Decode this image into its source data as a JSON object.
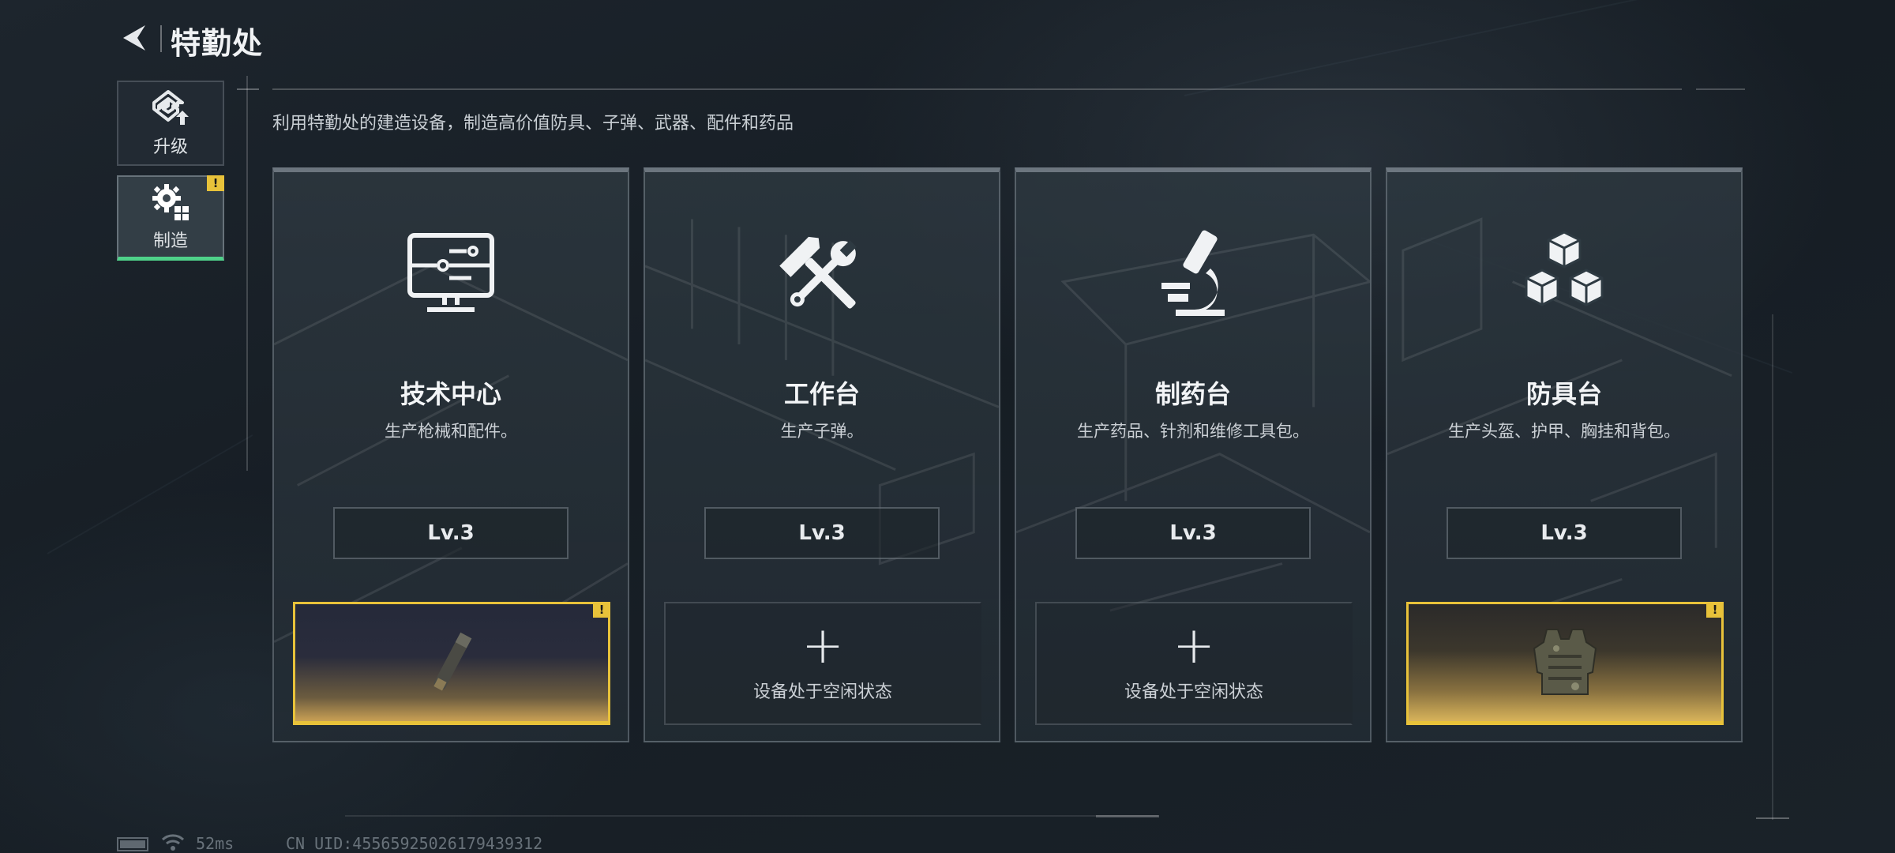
{
  "header": {
    "title": "特勤处"
  },
  "sidebar": {
    "items": [
      {
        "label": "升级",
        "icon": "upgrade-icon",
        "active": false
      },
      {
        "label": "制造",
        "icon": "gear-craft-icon",
        "active": true,
        "badge": "!"
      }
    ]
  },
  "description": "利用特勤处的建造设备，制造高价值防具、子弹、武器、配件和药品",
  "cards": [
    {
      "title": "技术中心",
      "subtitle": "生产枪械和配件。",
      "icon": "computer-icon",
      "level": "Lv.3",
      "slot": {
        "state": "busy",
        "badge": "!",
        "item_icon": "weapon-part-icon"
      }
    },
    {
      "title": "工作台",
      "subtitle": "生产子弹。",
      "icon": "hammer-wrench-icon",
      "level": "Lv.3",
      "slot": {
        "state": "idle",
        "plus": "+",
        "text": "设备处于空闲状态"
      }
    },
    {
      "title": "制药台",
      "subtitle": "生产药品、针剂和维修工具包。",
      "icon": "microscope-icon",
      "level": "Lv.3",
      "slot": {
        "state": "idle",
        "plus": "+",
        "text": "设备处于空闲状态"
      }
    },
    {
      "title": "防具台",
      "subtitle": "生产头盔、护甲、胸挂和背包。",
      "icon": "cubes-icon",
      "level": "Lv.3",
      "slot": {
        "state": "busy",
        "badge": "!",
        "item_icon": "body-armor-icon"
      }
    }
  ],
  "footer": {
    "ping": "52ms",
    "uid": "CN UID:455659250261794393​12"
  },
  "colors": {
    "accent_green": "#4fd28a",
    "badge_yellow": "#e8c23a",
    "background": "#1a2229"
  }
}
